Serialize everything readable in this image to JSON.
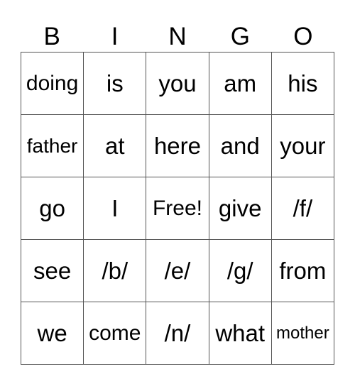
{
  "header": [
    "B",
    "I",
    "N",
    "G",
    "O"
  ],
  "cells": [
    [
      "doing",
      "is",
      "you",
      "am",
      "his"
    ],
    [
      "father",
      "at",
      "here",
      "and",
      "your"
    ],
    [
      "go",
      "I",
      "Free!",
      "give",
      "/f/"
    ],
    [
      "see",
      "/b/",
      "/e/",
      "/g/",
      "from"
    ],
    [
      "we",
      "come",
      "/n/",
      "what",
      "mother"
    ]
  ],
  "colors": {
    "border": "#555555",
    "text": "#000000",
    "background": "#ffffff"
  }
}
